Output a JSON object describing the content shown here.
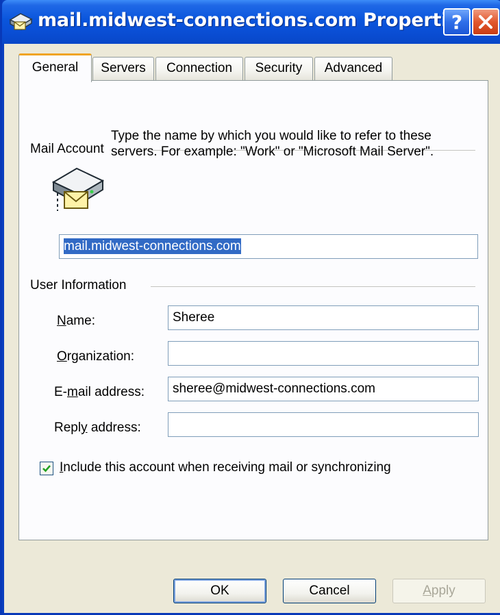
{
  "window": {
    "title": "mail.midwest-connections.com Properties",
    "help_label": "?",
    "accent": "#0a55dc"
  },
  "tabs": [
    {
      "label": "General",
      "active": true
    },
    {
      "label": "Servers",
      "active": false
    },
    {
      "label": "Connection",
      "active": false
    },
    {
      "label": "Security",
      "active": false
    },
    {
      "label": "Advanced",
      "active": false
    }
  ],
  "mail_account": {
    "group_label": "Mail Account",
    "description": "Type the name by which you would like to refer to these servers.  For example: \"Work\" or \"Microsoft Mail Server\".",
    "account_name_value": "mail.midwest-connections.com",
    "icon": "mail-server-icon"
  },
  "user_information": {
    "group_label": "User Information",
    "fields": {
      "name": {
        "label_mnemonic": "N",
        "label_rest": "ame:",
        "value": "Sheree"
      },
      "organization": {
        "label_mnemonic": "O",
        "label_rest": "rganization:",
        "value": ""
      },
      "email": {
        "label_prefix": "E-",
        "label_mnemonic": "m",
        "label_rest": "ail address:",
        "value": "sheree@midwest-connections.com"
      },
      "reply": {
        "label_prefix": "Repl",
        "label_mnemonic": "y",
        "label_rest": " address:",
        "value": ""
      }
    }
  },
  "include_account": {
    "checked": true,
    "label_mnemonic": "I",
    "label_rest": "nclude this account when receiving mail or synchronizing"
  },
  "buttons": {
    "ok": "OK",
    "cancel": "Cancel",
    "apply_mnemonic": "A",
    "apply_rest": "pply"
  }
}
